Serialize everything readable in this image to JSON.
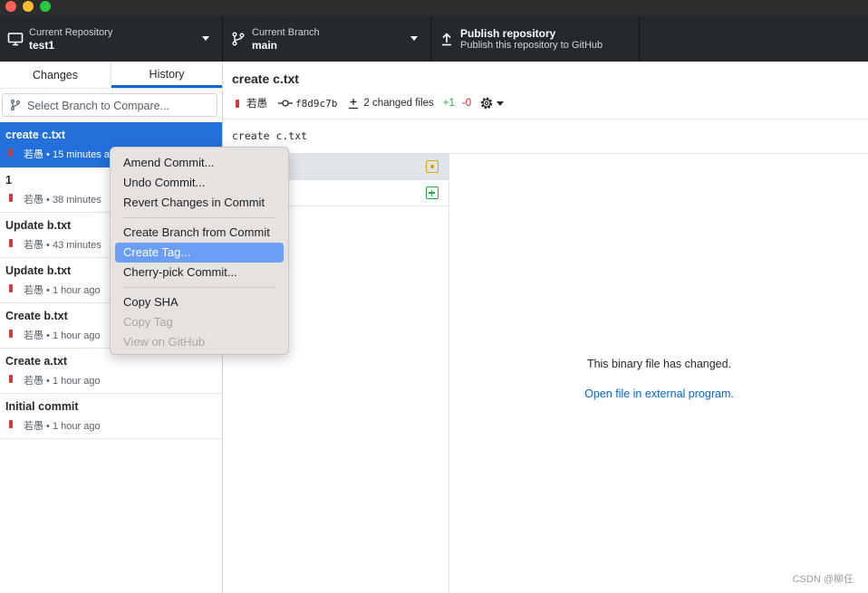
{
  "toolbar": {
    "repo": {
      "label": "Current Repository",
      "value": "test1"
    },
    "branch": {
      "label": "Current Branch",
      "value": "main"
    },
    "publish": {
      "title": "Publish repository",
      "subtitle": "Publish this repository to GitHub"
    }
  },
  "sidebar": {
    "tabs": [
      "Changes",
      "History"
    ],
    "compare_placeholder": "Select Branch to Compare...",
    "commits": [
      {
        "title": "create c.txt",
        "meta": "若愚 • 15 minutes a"
      },
      {
        "title": "1",
        "meta": "若愚 • 38 minutes"
      },
      {
        "title": "Update b.txt",
        "meta": "若愚 • 43 minutes"
      },
      {
        "title": "Update b.txt",
        "meta": "若愚 • 1 hour ago"
      },
      {
        "title": "Create b.txt",
        "meta": "若愚 • 1 hour ago"
      },
      {
        "title": "Create a.txt",
        "meta": "若愚 • 1 hour ago"
      },
      {
        "title": "Initial commit",
        "meta": "若愚 • 1 hour ago"
      }
    ]
  },
  "commit_detail": {
    "title": "create c.txt",
    "author": "若愚",
    "sha": "f8d9c7b",
    "changed_files": "2 changed files",
    "additions": "+1",
    "deletions": "-0",
    "description": "create c.txt"
  },
  "diff": {
    "message": "This binary file has changed.",
    "link": "Open file in external program."
  },
  "context_menu": {
    "items": [
      "Amend Commit...",
      "Undo Commit...",
      "Revert Changes in Commit",
      "Create Branch from Commit",
      "Create Tag...",
      "Cherry-pick Commit...",
      "Copy SHA",
      "Copy Tag",
      "View on GitHub"
    ]
  },
  "watermark": "CSDN @柳仼",
  "colors": {
    "toolbar_bg": "#24292e",
    "selected_commit": "#2470db",
    "menu_highlight": "#6b9ff6",
    "additions": "#28a745",
    "deletions": "#cb2431",
    "link": "#0366d6"
  }
}
